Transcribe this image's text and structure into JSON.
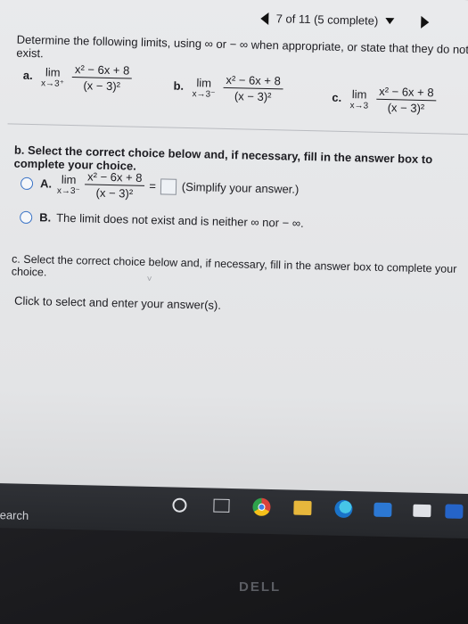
{
  "nav": {
    "progress": "7 of 11 (5 complete)"
  },
  "question": {
    "title": "Determine the following limits, using ∞ or − ∞ when appropriate, or state that they do not exist.",
    "parts": [
      {
        "label": "a.",
        "lim": "lim",
        "approach": "x→3⁺",
        "numerator": "x² − 6x + 8",
        "denominator": "(x − 3)²"
      },
      {
        "label": "b.",
        "lim": "lim",
        "approach": "x→3⁻",
        "numerator": "x² − 6x + 8",
        "denominator": "(x − 3)²"
      },
      {
        "label": "c.",
        "lim": "lim",
        "approach": "x→3",
        "numerator": "x² − 6x + 8",
        "denominator": "(x − 3)²"
      }
    ]
  },
  "part_b": {
    "instruction": "b. Select the correct choice below and, if necessary, fill in the answer box to complete your choice.",
    "choice_a": {
      "label": "A.",
      "lim": "lim",
      "approach": "x→3⁻",
      "numerator": "x² − 6x + 8",
      "denominator": "(x − 3)²",
      "equals": "=",
      "hint": "(Simplify your answer.)"
    },
    "choice_b": {
      "label": "B.",
      "text": "The limit does not exist and is neither ∞ nor − ∞."
    }
  },
  "part_c": {
    "instruction": "c. Select the correct choice below and, if necessary, fill in the answer box to complete your choice."
  },
  "footer": {
    "text": "Click to select and enter your answer(s)."
  },
  "taskbar": {
    "search_label": "search"
  },
  "brand": {
    "text": "DELL"
  }
}
